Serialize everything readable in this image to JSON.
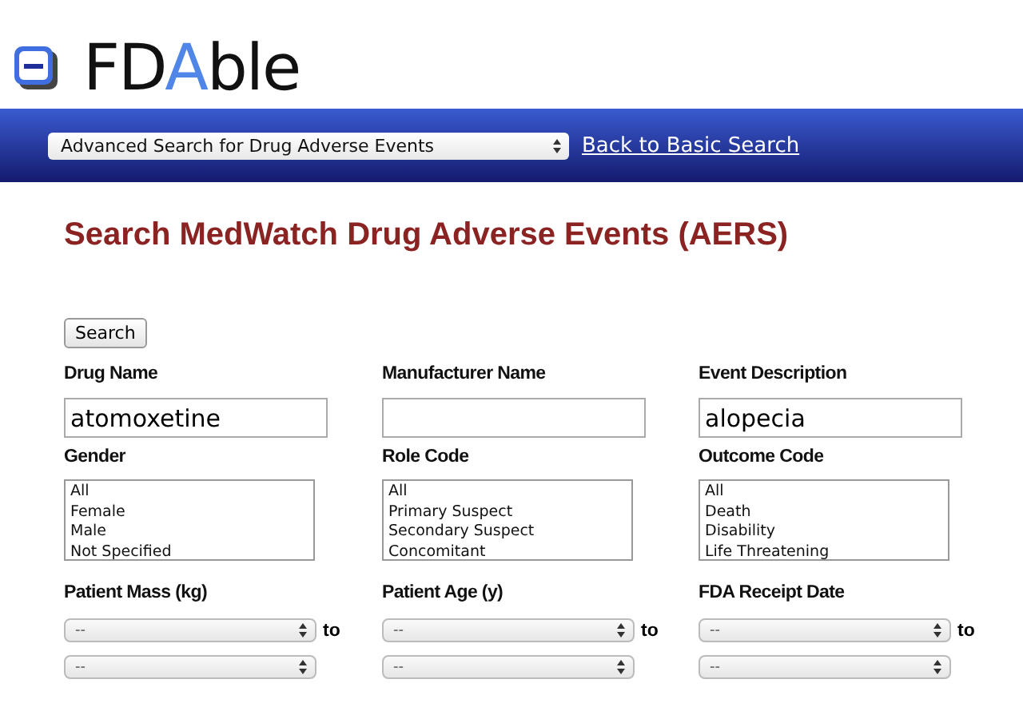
{
  "logo": {
    "parts": [
      {
        "text": "FD",
        "accent": false
      },
      {
        "text": "A",
        "accent": true
      },
      {
        "text": "ble",
        "accent": false
      }
    ]
  },
  "nav": {
    "select": "Advanced Search for Drug Adverse Events",
    "link": "Back to Basic Search"
  },
  "title": "Search MedWatch Drug Adverse Events (AERS)",
  "search_button": "Search",
  "text_fields": [
    {
      "label": "Drug Name",
      "value": "atomoxetine"
    },
    {
      "label": "Manufacturer Name"
    },
    {
      "label": "Event Description",
      "value": "alopecia"
    }
  ],
  "list_fields": [
    {
      "label": "Gender",
      "options": [
        "All",
        "Female",
        "Male",
        "Not Specified"
      ]
    },
    {
      "label": "Role Code",
      "options": [
        "All",
        "Primary Suspect",
        "Secondary Suspect",
        "Concomitant"
      ]
    },
    {
      "label": "Outcome Code",
      "options": [
        "All",
        "Death",
        "Disability",
        "Life Threatening"
      ]
    }
  ],
  "range_fields": [
    {
      "label": "Patient Mass (kg)",
      "from": "--",
      "to_word": "to",
      "to": "--"
    },
    {
      "label": "Patient Age (y)",
      "from": "--",
      "to_word": "to",
      "to": "--"
    },
    {
      "label": "FDA Receipt Date",
      "from": "--",
      "to_word": "to",
      "to": "--"
    }
  ]
}
